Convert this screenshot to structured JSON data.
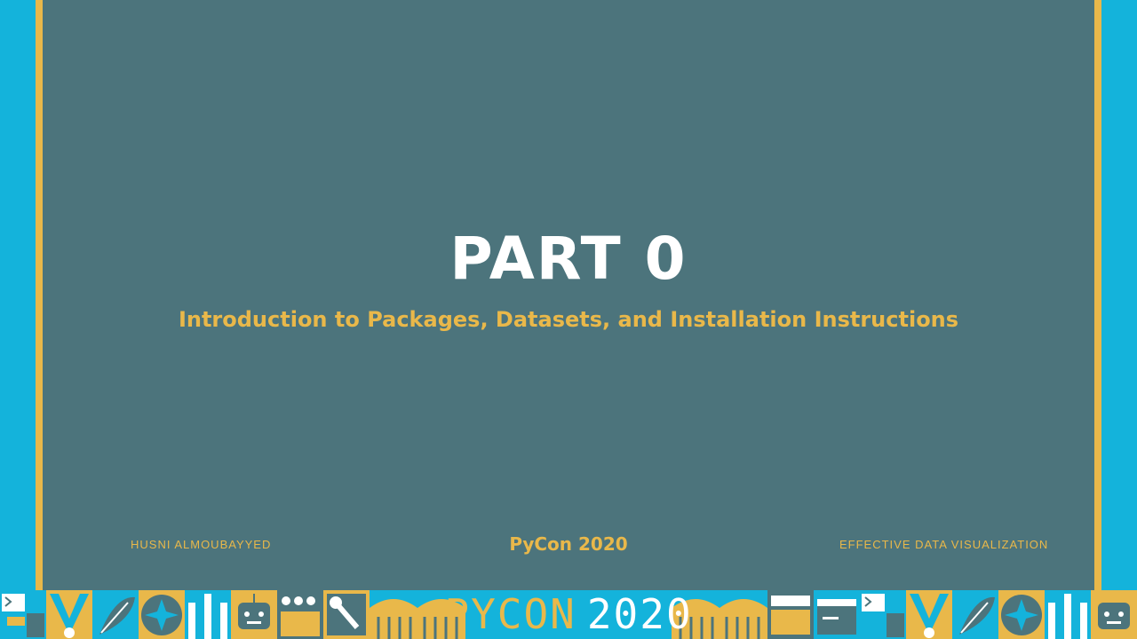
{
  "slide": {
    "title": "PART 0",
    "subtitle": "Introduction to Packages, Datasets, and Installation Instructions"
  },
  "footer": {
    "author": "HUSNI ALMOUBAYYED",
    "event": "PyCon 2020",
    "talk": "EFFECTIVE DATA VISUALIZATION"
  },
  "banner": {
    "logo_py": "PYCON",
    "logo_year": "2020",
    "tiles": [
      "terminal-icon",
      "v-shape-icon",
      "leaf-icon",
      "star-circle-icon",
      "pillars-icon",
      "robot-icon",
      "dots-icon",
      "wrench-icon",
      "arches-icon",
      "browser-icon",
      "terminal-icon",
      "v-shape-icon",
      "leaf-icon",
      "star-circle-icon",
      "pillars-icon",
      "robot-icon"
    ]
  },
  "colors": {
    "slide_bg": "#4c747c",
    "accent_gold": "#e9b84a",
    "accent_blue": "#14b3db",
    "title_white": "#ffffff"
  }
}
